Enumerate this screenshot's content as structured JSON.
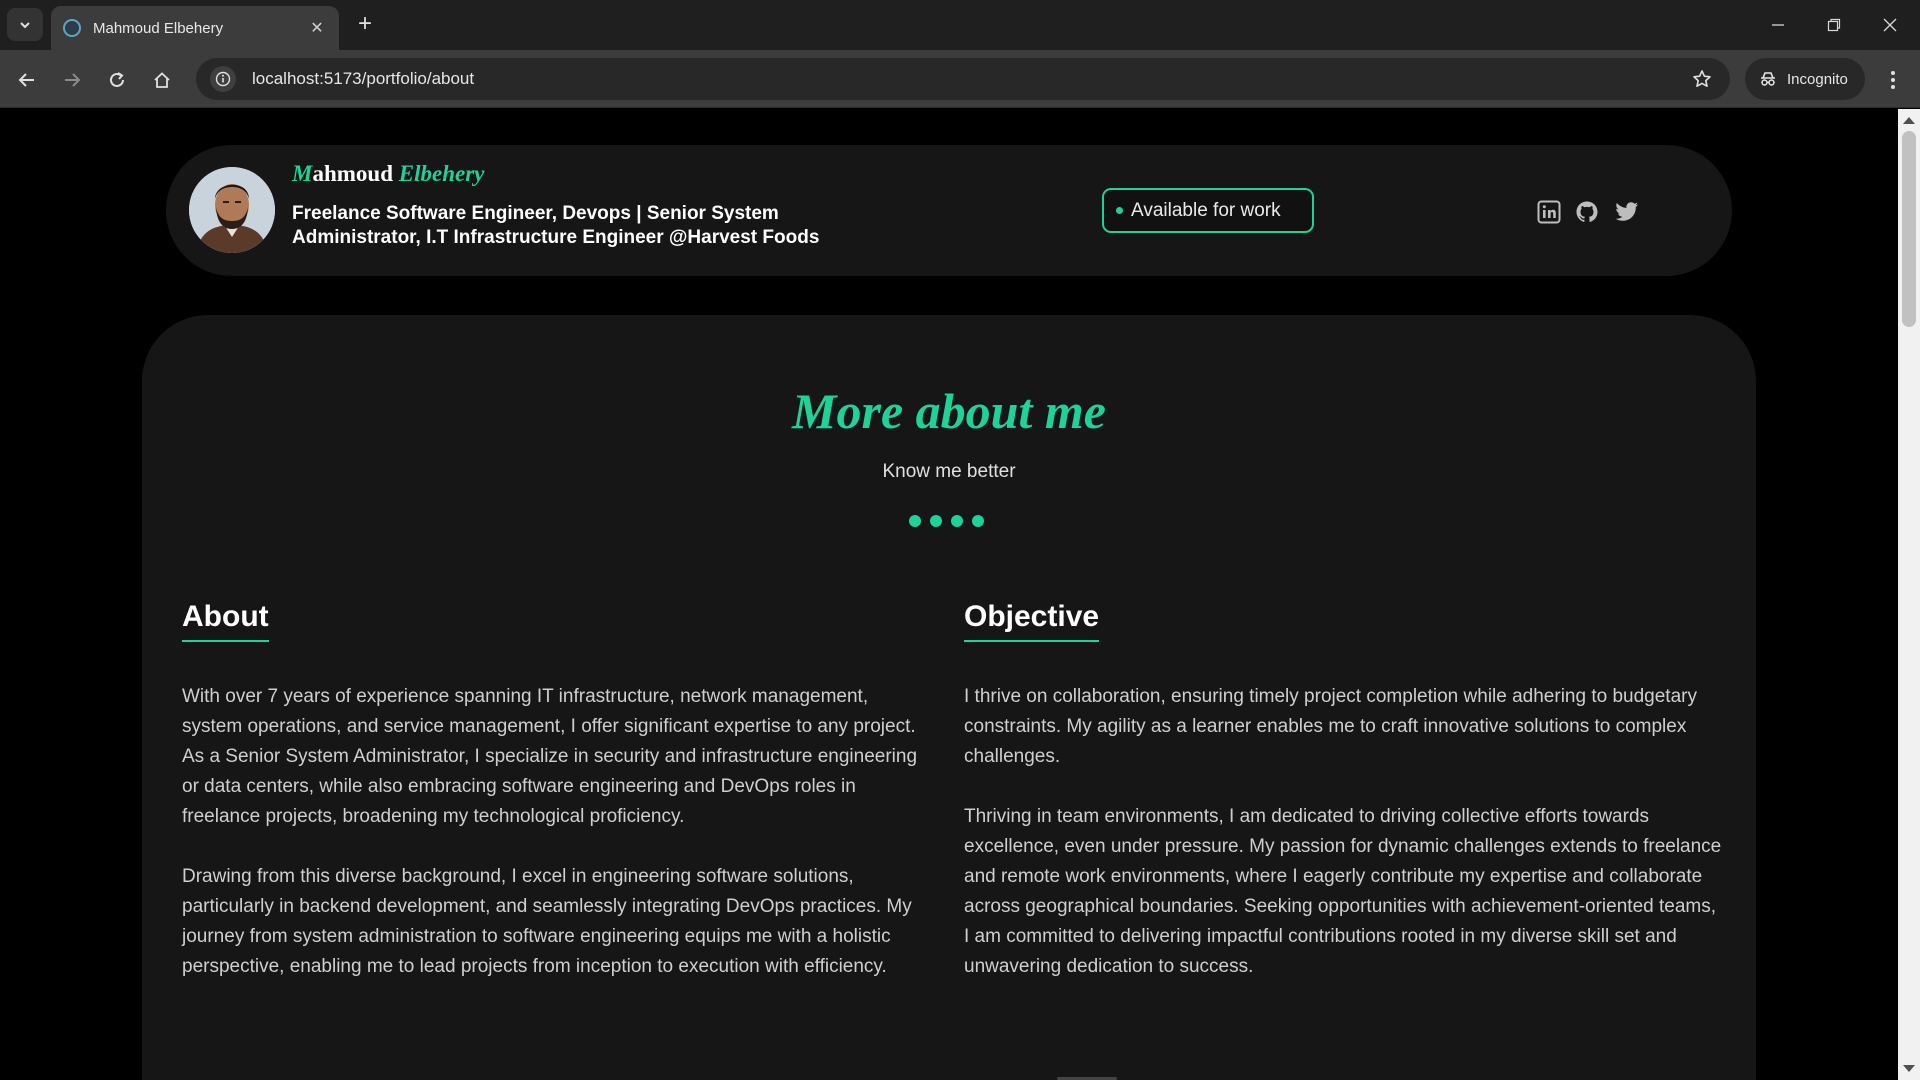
{
  "browser": {
    "tab_title": "Mahmoud Elbehery",
    "tab_close": "✕",
    "new_tab": "+",
    "url": "localhost:5173/portfolio/about",
    "incognito_label": "Incognito"
  },
  "profile": {
    "name_first": "Mahmoud",
    "name_last": "Elbehery",
    "role": "Freelance Software Engineer, Devops | Senior System Administrator, I.T Infrastructure Engineer @Harvest Foods",
    "availability": "Available for work",
    "social_icons": [
      "linkedin-icon",
      "github-icon",
      "twitter-icon"
    ]
  },
  "section": {
    "title": "More about me",
    "subtitle": "Know me better"
  },
  "about": {
    "heading": "About",
    "paragraphs": [
      "With over 7 years of experience spanning IT infrastructure, network management, system operations, and service management, I offer significant expertise to any project. As a Senior System Administrator, I specialize in security and infrastructure engineering or data centers, while also embracing software engineering and DevOps roles in freelance projects, broadening my technological proficiency.",
      "Drawing from this diverse background, I excel in engineering software solutions, particularly in backend development, and seamlessly integrating DevOps practices. My journey from system administration to software engineering equips me with a holistic perspective, enabling me to lead projects from inception to execution with efficiency."
    ]
  },
  "objective": {
    "heading": "Objective",
    "paragraphs": [
      "I thrive on collaboration, ensuring timely project completion while adhering to budgetary constraints. My agility as a learner enables me to craft innovative solutions to complex challenges.",
      "Thriving in team environments, I am dedicated to driving collective efforts towards excellence, even under pressure. My passion for dynamic challenges extends to freelance and remote work environments, where I eagerly contribute my expertise and collaborate across geographical boundaries. Seeking opportunities with achievement-oriented teams, I am committed to delivering impactful contributions rooted in my diverse skill set and unwavering dedication to success."
    ]
  },
  "colors": {
    "accent": "#1ed39a",
    "panel": "#161616",
    "background": "#000000"
  }
}
